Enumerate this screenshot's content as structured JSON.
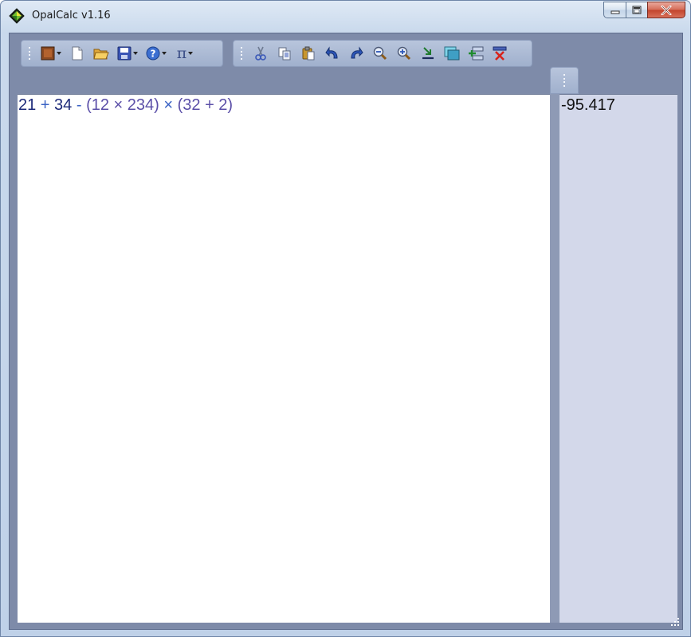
{
  "window": {
    "title": "OpalCalc v1.16",
    "colors": {
      "frame": "#c9d9ec",
      "client": "#7e8ba9",
      "results_bg": "#d3d8ea",
      "close": "#c2432b"
    }
  },
  "toolbar_main": {
    "items": [
      {
        "icon": "theme-icon",
        "has_dropdown": true
      },
      {
        "icon": "new-document-icon"
      },
      {
        "icon": "open-folder-icon"
      },
      {
        "icon": "save-icon",
        "has_dropdown": true
      },
      {
        "icon": "help-icon",
        "has_dropdown": true
      },
      {
        "icon": "pi-constants-icon",
        "label": "π",
        "has_dropdown": true
      }
    ]
  },
  "toolbar_edit": {
    "items": [
      {
        "icon": "cut-icon"
      },
      {
        "icon": "copy-icon"
      },
      {
        "icon": "paste-icon"
      },
      {
        "icon": "undo-icon"
      },
      {
        "icon": "redo-icon"
      },
      {
        "icon": "zoom-out-icon"
      },
      {
        "icon": "zoom-in-icon"
      },
      {
        "icon": "insert-result-icon"
      },
      {
        "icon": "window-icon"
      },
      {
        "icon": "add-line-icon"
      },
      {
        "icon": "clear-icon"
      }
    ]
  },
  "editor": {
    "expression_tokens": [
      {
        "text": "21",
        "kind": "num"
      },
      {
        "text": " + ",
        "kind": "op"
      },
      {
        "text": "34",
        "kind": "num"
      },
      {
        "text": " - ",
        "kind": "op"
      },
      {
        "text": "(12 × 234)",
        "kind": "muted"
      },
      {
        "text": " × ",
        "kind": "op"
      },
      {
        "text": "(32 + 2)",
        "kind": "muted"
      }
    ]
  },
  "results": {
    "lines": [
      "-95.417"
    ]
  }
}
